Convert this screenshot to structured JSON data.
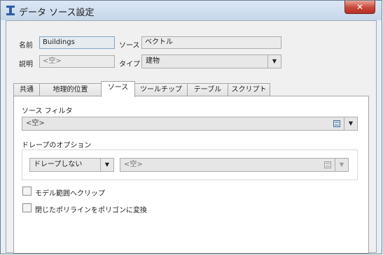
{
  "window": {
    "title": "データ ソース設定",
    "close_label": "✕"
  },
  "header": {
    "name_label": "名前",
    "name_value": "Buildings",
    "source_label": "ソース",
    "source_value": "ベクトル",
    "description_label": "説明",
    "description_placeholder": "<空>",
    "type_label": "タイプ",
    "type_value": "建物"
  },
  "tabs": [
    {
      "label": "共通",
      "active": false
    },
    {
      "label": "地理的位置",
      "active": false
    },
    {
      "label": "ソース",
      "active": true
    },
    {
      "label": "ツールチップ",
      "active": false
    },
    {
      "label": "テーブル",
      "active": false
    },
    {
      "label": "スクリプト",
      "active": false
    }
  ],
  "source_tab": {
    "filter_label": "ソース フィルタ",
    "filter_value": "<空>",
    "drape_label": "ドレープのオプション",
    "drape_mode": "ドレープしない",
    "drape_source": "<空>",
    "clip_label": "モデル範囲へクリップ",
    "clip_checked": false,
    "convert_label": "閉じたポリラインをポリゴンに変換",
    "convert_checked": false
  },
  "icons": {
    "app": "app-icon",
    "expression": "expression-icon",
    "dropdown": "chevron-down-icon"
  }
}
